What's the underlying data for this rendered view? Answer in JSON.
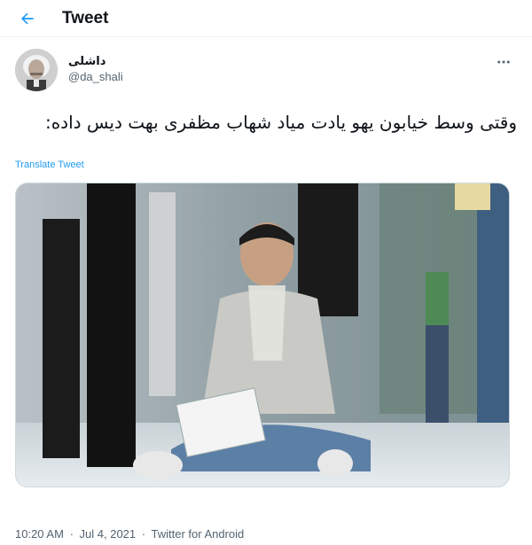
{
  "header": {
    "title": "Tweet",
    "back_icon": "arrow-left-icon",
    "accent_color": "#1d9bf0"
  },
  "tweet": {
    "author": {
      "display_name": "داشلی",
      "handle": "@da_shali"
    },
    "more_icon": "more-dots-icon",
    "text": "وقتی وسط خیابون یهو یادت میاد شهاب مظفری بهت دیس داده:",
    "translate_label": "Translate Tweet",
    "media_description_icon": "photo",
    "time": "10:20 AM",
    "date": "Jul 4, 2021",
    "source": "Twitter for Android",
    "separator": "·"
  }
}
